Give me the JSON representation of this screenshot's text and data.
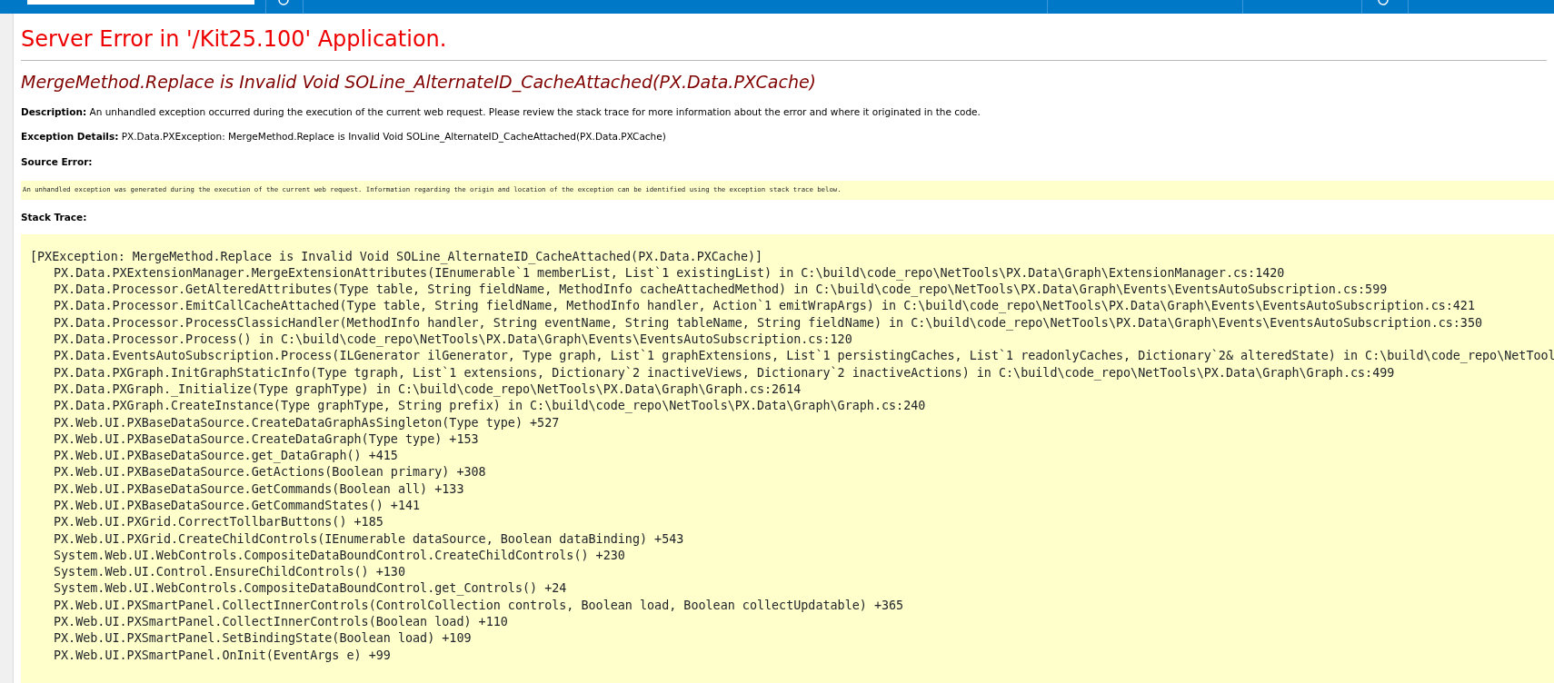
{
  "error_title": "Server Error in '/Kit25.100' Application.",
  "exception_message": "MergeMethod.Replace is Invalid Void SOLine_AlternateID_CacheAttached(PX.Data.PXCache)",
  "fields": [
    {
      "label": "Description:",
      "text": "An unhandled exception occurred during the execution of the current web request. Please review the stack trace for more information about the error and where it originated in the code."
    },
    {
      "label": "Exception Details:",
      "text": "PX.Data.PXException: MergeMethod.Replace is Invalid Void SOLine_AlternateID_CacheAttached(PX.Data.PXCache)"
    }
  ],
  "source_error": {
    "label": "Source Error:",
    "text": "An unhandled exception was generated during the execution of the current web request. Information regarding the origin and location of the exception can be identified using the exception stack trace below."
  },
  "stack_trace": {
    "label": "Stack Trace:",
    "lines": [
      {
        "kind": "header",
        "text": "[PXException: MergeMethod.Replace is Invalid Void SOLine_AlternateID_CacheAttached(PX.Data.PXCache)]"
      },
      {
        "kind": "frame",
        "text": "PX.Data.PXExtensionManager.MergeExtensionAttributes(IEnumerable`1 memberList, List`1 existingList) in C:\\build\\code_repo\\NetTools\\PX.Data\\Graph\\ExtensionManager.cs:1420"
      },
      {
        "kind": "frame",
        "text": "PX.Data.Processor.GetAlteredAttributes(Type table, String fieldName, MethodInfo cacheAttachedMethod) in C:\\build\\code_repo\\NetTools\\PX.Data\\Graph\\Events\\EventsAutoSubscription.cs:599"
      },
      {
        "kind": "frame",
        "text": "PX.Data.Processor.EmitCallCacheAttached(Type table, String fieldName, MethodInfo handler, Action`1 emitWrapArgs) in C:\\build\\code_repo\\NetTools\\PX.Data\\Graph\\Events\\EventsAutoSubscription.cs:421"
      },
      {
        "kind": "frame",
        "text": "PX.Data.Processor.ProcessClassicHandler(MethodInfo handler, String eventName, String tableName, String fieldName) in C:\\build\\code_repo\\NetTools\\PX.Data\\Graph\\Events\\EventsAutoSubscription.cs:350"
      },
      {
        "kind": "frame",
        "text": "PX.Data.Processor.Process() in C:\\build\\code_repo\\NetTools\\PX.Data\\Graph\\Events\\EventsAutoSubscription.cs:120"
      },
      {
        "kind": "frame",
        "text": "PX.Data.EventsAutoSubscription.Process(ILGenerator ilGenerator, Type graph, List`1 graphExtensions, List`1 persistingCaches, List`1 readonlyCaches, Dictionary`2& alteredState) in C:\\build\\code_repo\\NetTool"
      },
      {
        "kind": "frame",
        "text": "PX.Data.PXGraph.InitGraphStaticInfo(Type tgraph, List`1 extensions, Dictionary`2 inactiveViews, Dictionary`2 inactiveActions) in C:\\build\\code_repo\\NetTools\\PX.Data\\Graph\\Graph.cs:499"
      },
      {
        "kind": "frame",
        "text": "PX.Data.PXGraph._Initialize(Type graphType) in C:\\build\\code_repo\\NetTools\\PX.Data\\Graph\\Graph.cs:2614"
      },
      {
        "kind": "frame",
        "text": "PX.Data.PXGraph.CreateInstance(Type graphType, String prefix) in C:\\build\\code_repo\\NetTools\\PX.Data\\Graph\\Graph.cs:240"
      },
      {
        "kind": "frame",
        "text": "PX.Web.UI.PXBaseDataSource.CreateDataGraphAsSingleton(Type type) +527"
      },
      {
        "kind": "frame",
        "text": "PX.Web.UI.PXBaseDataSource.CreateDataGraph(Type type) +153"
      },
      {
        "kind": "frame",
        "text": "PX.Web.UI.PXBaseDataSource.get_DataGraph() +415"
      },
      {
        "kind": "frame",
        "text": "PX.Web.UI.PXBaseDataSource.GetActions(Boolean primary) +308"
      },
      {
        "kind": "frame",
        "text": "PX.Web.UI.PXBaseDataSource.GetCommands(Boolean all) +133"
      },
      {
        "kind": "frame",
        "text": "PX.Web.UI.PXBaseDataSource.GetCommandStates() +141"
      },
      {
        "kind": "frame",
        "text": "PX.Web.UI.PXGrid.CorrectTollbarButtons() +185"
      },
      {
        "kind": "frame",
        "text": "PX.Web.UI.PXGrid.CreateChildControls(IEnumerable dataSource, Boolean dataBinding) +543"
      },
      {
        "kind": "frame",
        "text": "System.Web.UI.WebControls.CompositeDataBoundControl.CreateChildControls() +230"
      },
      {
        "kind": "frame",
        "text": "System.Web.UI.Control.EnsureChildControls() +130"
      },
      {
        "kind": "frame",
        "text": "System.Web.UI.WebControls.CompositeDataBoundControl.get_Controls() +24"
      },
      {
        "kind": "frame",
        "text": "PX.Web.UI.PXSmartPanel.CollectInnerControls(ControlCollection controls, Boolean load, Boolean collectUpdatable) +365"
      },
      {
        "kind": "frame",
        "text": "PX.Web.UI.PXSmartPanel.CollectInnerControls(Boolean load) +110"
      },
      {
        "kind": "frame",
        "text": "PX.Web.UI.PXSmartPanel.SetBindingState(Boolean load) +109"
      },
      {
        "kind": "frame",
        "text": "PX.Web.UI.PXSmartPanel.OnInit(EventArgs e) +99"
      }
    ]
  }
}
